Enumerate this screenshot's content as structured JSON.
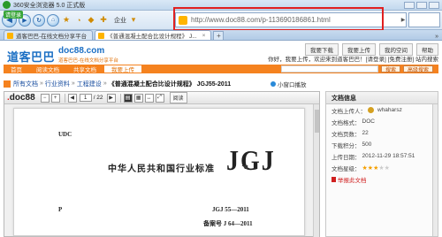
{
  "browser": {
    "title": "360安全浏览器 5.0 正式版",
    "login_badge": "请登录",
    "cloud_label": "企业",
    "address_url": "http://www.doc88.com/p-113690186861.html",
    "nav_back_glyph": "◀",
    "nav_forward_glyph": "▶",
    "nav_refresh_glyph": "↻",
    "nav_home_glyph": "⌂"
  },
  "tabs": [
    {
      "label": "道客巴巴-在线文档分享平台",
      "active": false
    },
    {
      "label": "《普通混凝土配合比设计规程》 J...",
      "active": true
    }
  ],
  "tab_new_glyph": "+",
  "tab_close_glyph": "×",
  "tab_expand_glyph": "»",
  "header": {
    "top_links": [
      "我要下载",
      "我要上传",
      "我的空间",
      "帮助"
    ],
    "logo_text": "道客巴巴",
    "domain": "doc88.com",
    "slogan": "道客巴巴-在线文档分享平台",
    "user_strip": "你好，我要上传，欢迎来到道客巴巴！[请登录] [免费注册] 站内搜索"
  },
  "menu": {
    "items": [
      "首页",
      "阅读文档",
      "共享文档",
      "我要上传"
    ],
    "active_index": 3,
    "search_btn": "搜索",
    "advanced_btn": "高级搜索"
  },
  "breadcrumb": {
    "items": [
      "所有文档",
      "行业资料",
      "工程建设"
    ],
    "sep": "»",
    "doc_title": "《普通混凝土配合比设计规程》 JGJ55-2011"
  },
  "mini_play": "小窗口播放",
  "viewer": {
    "logo_prefix": ".",
    "logo_text": "doc88",
    "page_current": "1",
    "page_total": "/ 22",
    "read_btn": "阅读"
  },
  "document": {
    "udc": "UDC",
    "standard_name": "中华人民共和国行业标准",
    "jgj_big": "JGJ",
    "p": "P",
    "code1": "JGJ 55—2011",
    "code2": "备案号 J 64—2011"
  },
  "info": {
    "title": "文档信息",
    "uploader_label": "文档上传人：",
    "uploader_value": "whaharsz",
    "format_label": "文档格式：",
    "format_value": "DOC",
    "pages_label": "文档页数：",
    "pages_value": "22",
    "downloads_label": "下载积分：",
    "downloads_value": "500",
    "upload_time_label": "上传日期：",
    "upload_time_value": "2012-11-29 18:57:51",
    "rating_label": "文档星级：",
    "rating_value": 3,
    "rating_max": 5,
    "report_label": "举报此文档"
  }
}
